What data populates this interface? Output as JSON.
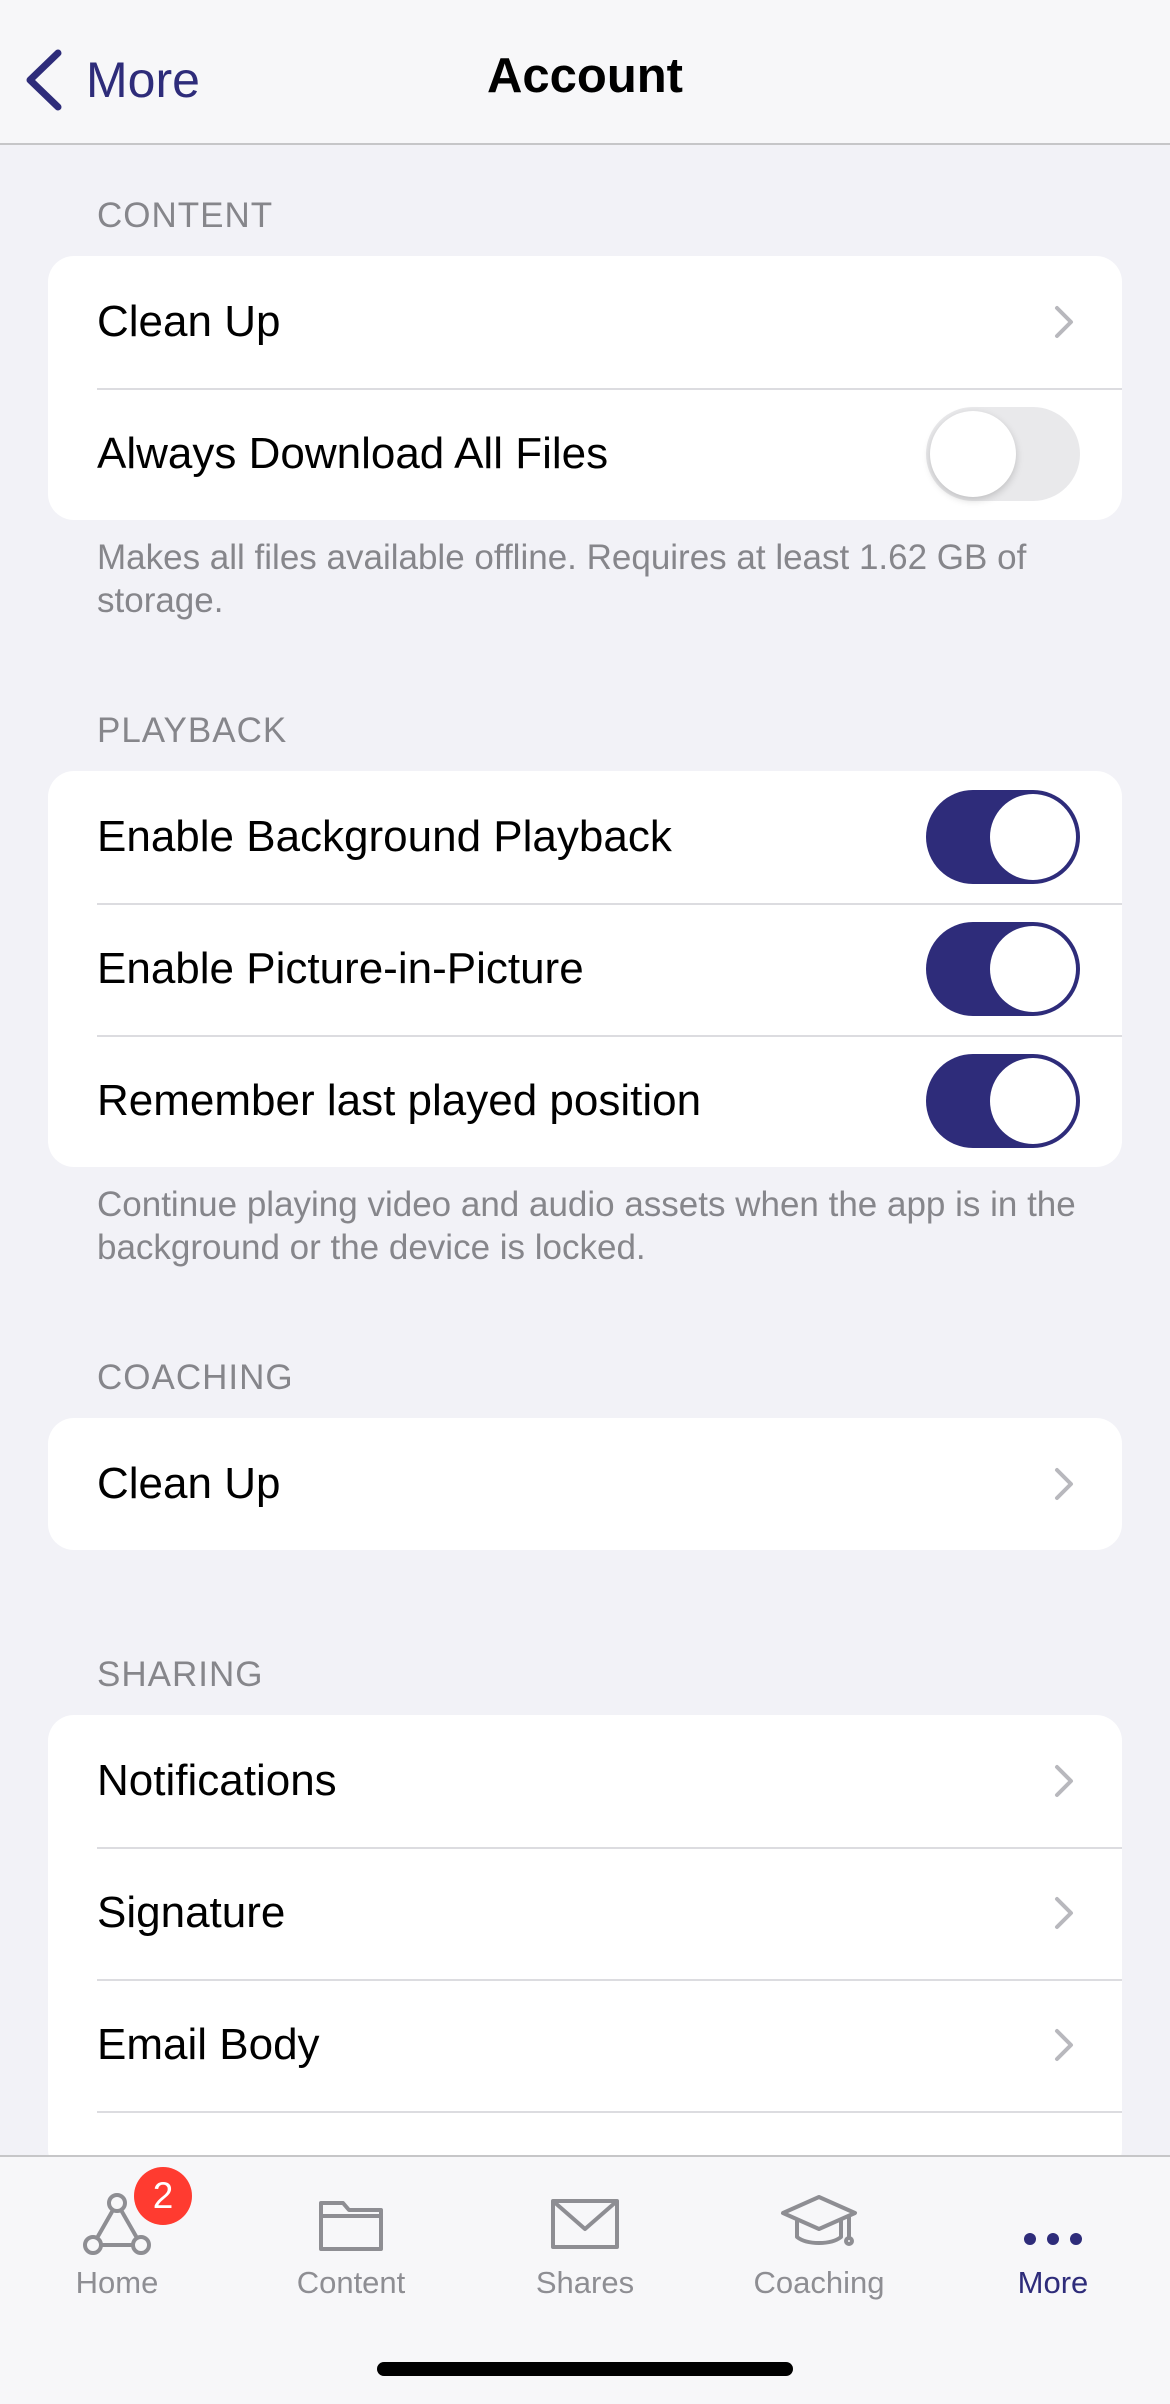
{
  "nav": {
    "back_label": "More",
    "title": "Account"
  },
  "sections": {
    "content": {
      "header": "CONTENT",
      "rows": [
        {
          "label": "Clean Up"
        },
        {
          "label": "Always Download All Files",
          "toggle_on": false
        }
      ],
      "footer": "Makes all files available offline. Requires at least 1.62 GB of storage."
    },
    "playback": {
      "header": "PLAYBACK",
      "rows": [
        {
          "label": "Enable Background Playback",
          "toggle_on": true
        },
        {
          "label": "Enable Picture-in-Picture",
          "toggle_on": true
        },
        {
          "label": "Remember last played position",
          "toggle_on": true
        }
      ],
      "footer": "Continue playing video and audio assets when the app is in the background or the device is locked."
    },
    "coaching": {
      "header": "COACHING",
      "rows": [
        {
          "label": "Clean Up"
        }
      ]
    },
    "sharing": {
      "header": "SHARING",
      "rows": [
        {
          "label": "Notifications"
        },
        {
          "label": "Signature"
        },
        {
          "label": "Email Body"
        }
      ]
    }
  },
  "tabbar": {
    "tabs": [
      {
        "label": "Home",
        "icon": "home-network-icon",
        "badge": "2"
      },
      {
        "label": "Content",
        "icon": "folder-icon"
      },
      {
        "label": "Shares",
        "icon": "envelope-icon"
      },
      {
        "label": "Coaching",
        "icon": "graduation-cap-icon"
      },
      {
        "label": "More",
        "icon": "ellipsis-icon",
        "active": true
      }
    ]
  },
  "colors": {
    "accent": "#2e2c7a",
    "background": "#f2f2f7",
    "badge": "#ff3b30",
    "secondary_text": "#86868b"
  }
}
